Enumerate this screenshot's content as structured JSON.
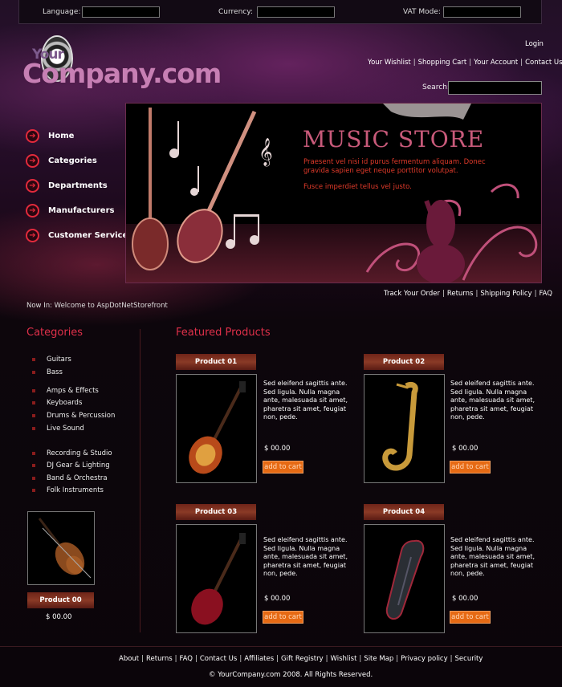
{
  "topbar": {
    "language_label": "Language:",
    "currency_label": "Currency:",
    "vat_label": "VAT Mode:"
  },
  "logo": {
    "line1": "Your",
    "line2": "Company.com"
  },
  "header": {
    "login": "Login",
    "links": [
      "Your Wishlist",
      "Shopping Cart",
      "Your Account",
      "Contact Us"
    ],
    "search_label": "Search:"
  },
  "nav": {
    "items": [
      "Home",
      "Categories",
      "Departments",
      "Manufacturers",
      "Customer Service"
    ]
  },
  "banner": {
    "title": "MUSIC STORE",
    "copy1": "Praesent vel nisi id purus fermentum aliquam. Donec gravida sapien eget neque porttitor volutpat.",
    "copy2": "Fusce imperdiet tellus vel justo."
  },
  "subnav": {
    "links": [
      "Track Your Order",
      "Returns",
      "Shipping Policy",
      "FAQ"
    ]
  },
  "now_in": "Now In: Welcome to AspDotNetStorefront",
  "categories": {
    "title": "Categories",
    "items": [
      "Guitars",
      "Bass",
      "Amps & Effects",
      "Keyboards",
      "Drums & Percussion",
      "Live Sound",
      "Recording & Studio",
      "DJ Gear & Lighting",
      "Band & Orchestra",
      "Folk Instruments"
    ]
  },
  "side_product": {
    "name": "Product 00",
    "price": "$ 00.00",
    "image": "violin-image"
  },
  "featured": {
    "title": "Featured Products",
    "products": [
      {
        "name": "Product 01",
        "desc": "Sed eleifend sagittis ante. Sed ligula. Nulla magna ante, malesuada sit amet, pharetra sit amet, feugiat non, pede.",
        "price": "$ 00.00",
        "cta": "add to cart",
        "image": "electric-guitar-sunburst-image"
      },
      {
        "name": "Product 02",
        "desc": "Sed eleifend sagittis ante. Sed ligula. Nulla magna ante, malesuada sit amet, pharetra sit amet, feugiat non, pede.",
        "price": "$ 00.00",
        "cta": "add to cart",
        "image": "saxophone-image"
      },
      {
        "name": "Product 03",
        "desc": "Sed eleifend sagittis ante. Sed ligula. Nulla magna ante, malesuada sit amet, pharetra sit amet, feugiat non, pede.",
        "price": "$ 00.00",
        "cta": "add to cart",
        "image": "electric-guitar-red-image"
      },
      {
        "name": "Product 04",
        "desc": "Sed eleifend sagittis ante. Sed ligula. Nulla magna ante, malesuada sit amet, pharetra sit amet, feugiat non, pede.",
        "price": "$ 00.00",
        "cta": "add to cart",
        "image": "instrument-case-image"
      }
    ]
  },
  "footer": {
    "links": [
      "About",
      "Returns",
      "FAQ",
      "Contact Us",
      "Affiliates",
      "Gift Registry",
      "Wishlist",
      "Site Map",
      "Privacy policy",
      "Security"
    ],
    "copyright": "© YourCompany.com 2008.  All Rights Reserved."
  },
  "colors": {
    "accent_red": "#e0304a",
    "button_orange": "#e66a14",
    "tab_brown": "#7a2c1e"
  }
}
